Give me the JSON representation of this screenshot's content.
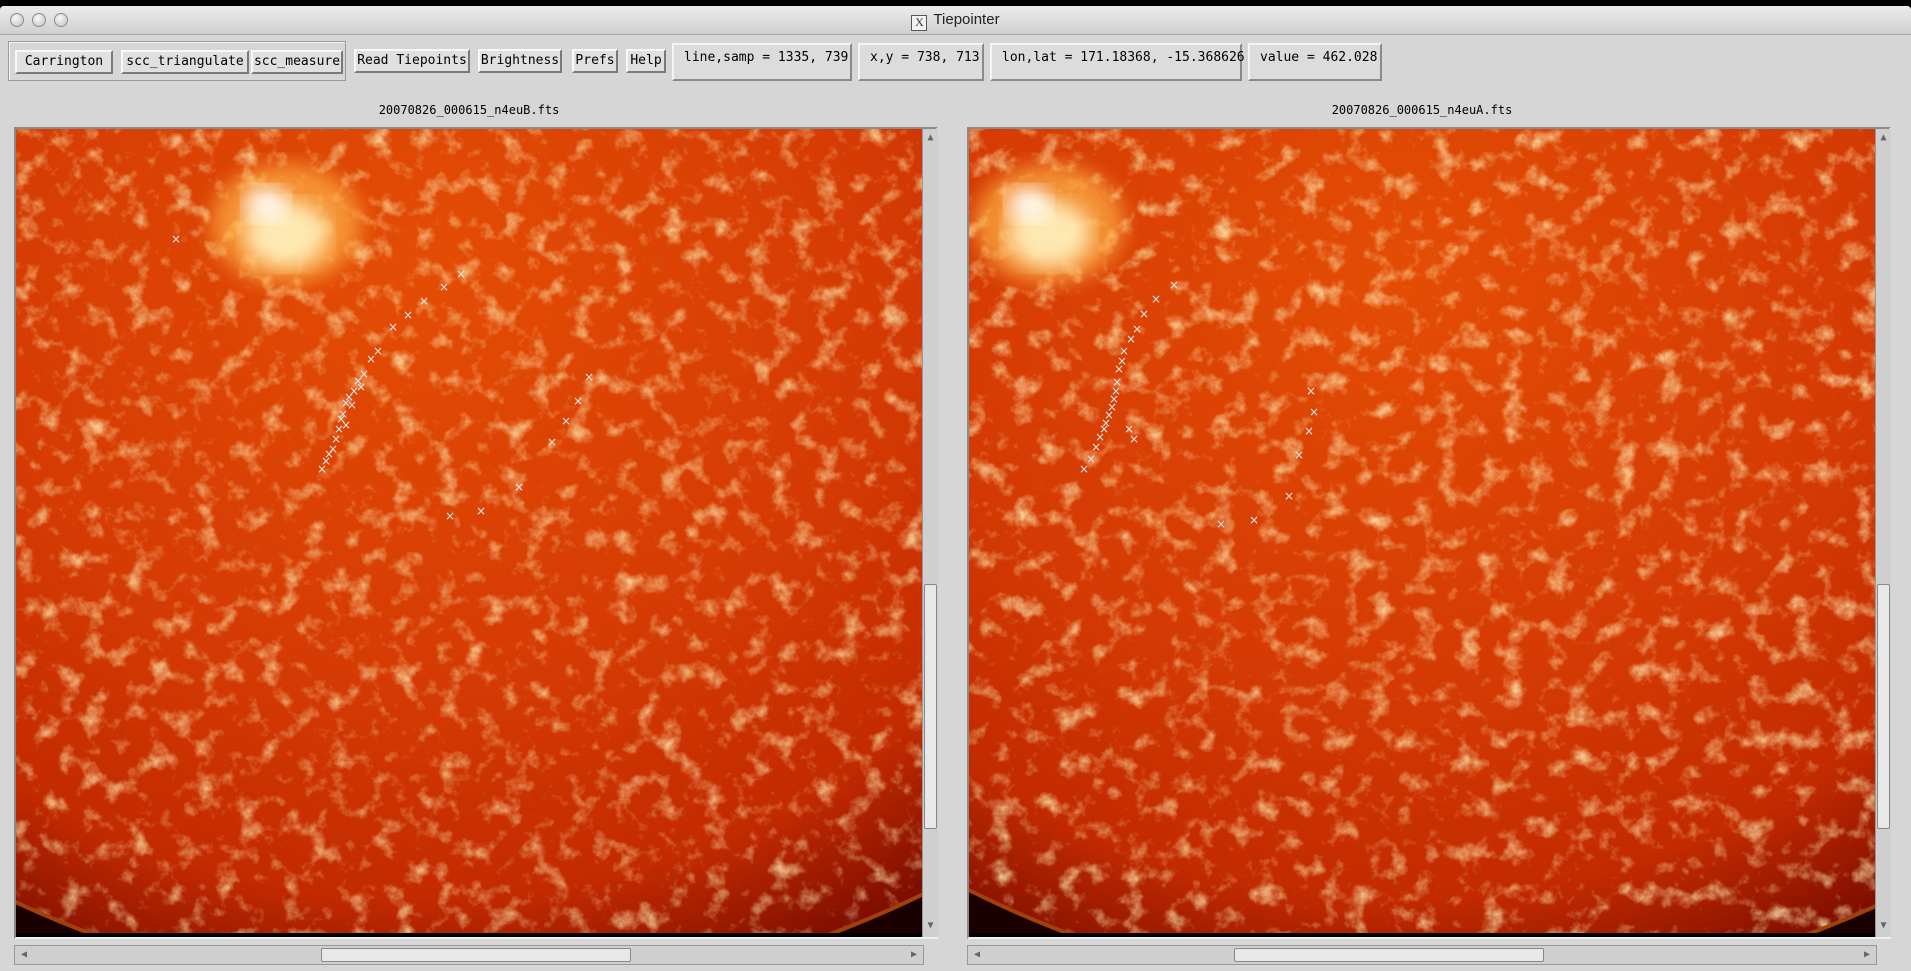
{
  "window": {
    "title": "Tiepointer"
  },
  "toolbar": {
    "buttons": [
      "Carrington",
      "scc_triangulate",
      "scc_measure",
      "Read Tiepoints",
      "Brightness",
      "Prefs",
      "Help"
    ]
  },
  "readouts": {
    "line_samp": "line,samp = 1335, 739",
    "xy": "x,y = 738, 713",
    "lon_lat": "lon,lat = 171.18368, -15.368626",
    "value": "value = 462.028"
  },
  "images": [
    {
      "filename": "20070826_000615_n4euB.fts",
      "marker_glyph": "×"
    },
    {
      "filename": "20070826_000615_n4euA.fts",
      "marker_glyph": "×"
    }
  ],
  "colors": {
    "sun_bright": "#fff2c0",
    "sun_mid": "#e44d05",
    "sun_dark": "#7a0c00",
    "space": "#1a0000"
  },
  "icons": {
    "close": "traffic-light-close-icon",
    "minimize": "traffic-light-minimize-icon",
    "zoom": "traffic-light-zoom-icon",
    "app": "x11-icon"
  }
}
